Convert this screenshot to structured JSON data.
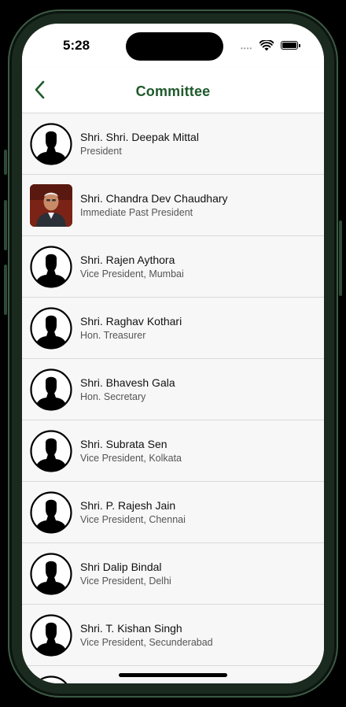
{
  "status": {
    "time": "5:28"
  },
  "nav": {
    "title": "Committee"
  },
  "members": [
    {
      "name": "Shri. Shri. Deepak Mittal",
      "role": "President",
      "photo": false
    },
    {
      "name": "Shri. Chandra Dev Chaudhary",
      "role": "Immediate Past President",
      "photo": true
    },
    {
      "name": "Shri. Rajen Aythora",
      "role": "Vice President, Mumbai",
      "photo": false
    },
    {
      "name": "Shri. Raghav Kothari",
      "role": "Hon. Treasurer",
      "photo": false
    },
    {
      "name": "Shri. Bhavesh Gala",
      "role": "Hon. Secretary",
      "photo": false
    },
    {
      "name": "Shri. Subrata Sen",
      "role": "Vice President, Kolkata",
      "photo": false
    },
    {
      "name": "Shri. P. Rajesh Jain",
      "role": "Vice President, Chennai",
      "photo": false
    },
    {
      "name": "Shri Dalip Bindal",
      "role": "Vice President, Delhi",
      "photo": false
    },
    {
      "name": "Shri. T. Kishan Singh",
      "role": "Vice President, Secunderabad",
      "photo": false
    }
  ],
  "colors": {
    "accent": "#1e5a2b",
    "background": "#f7f7f7",
    "divider": "#d9d9d9"
  }
}
